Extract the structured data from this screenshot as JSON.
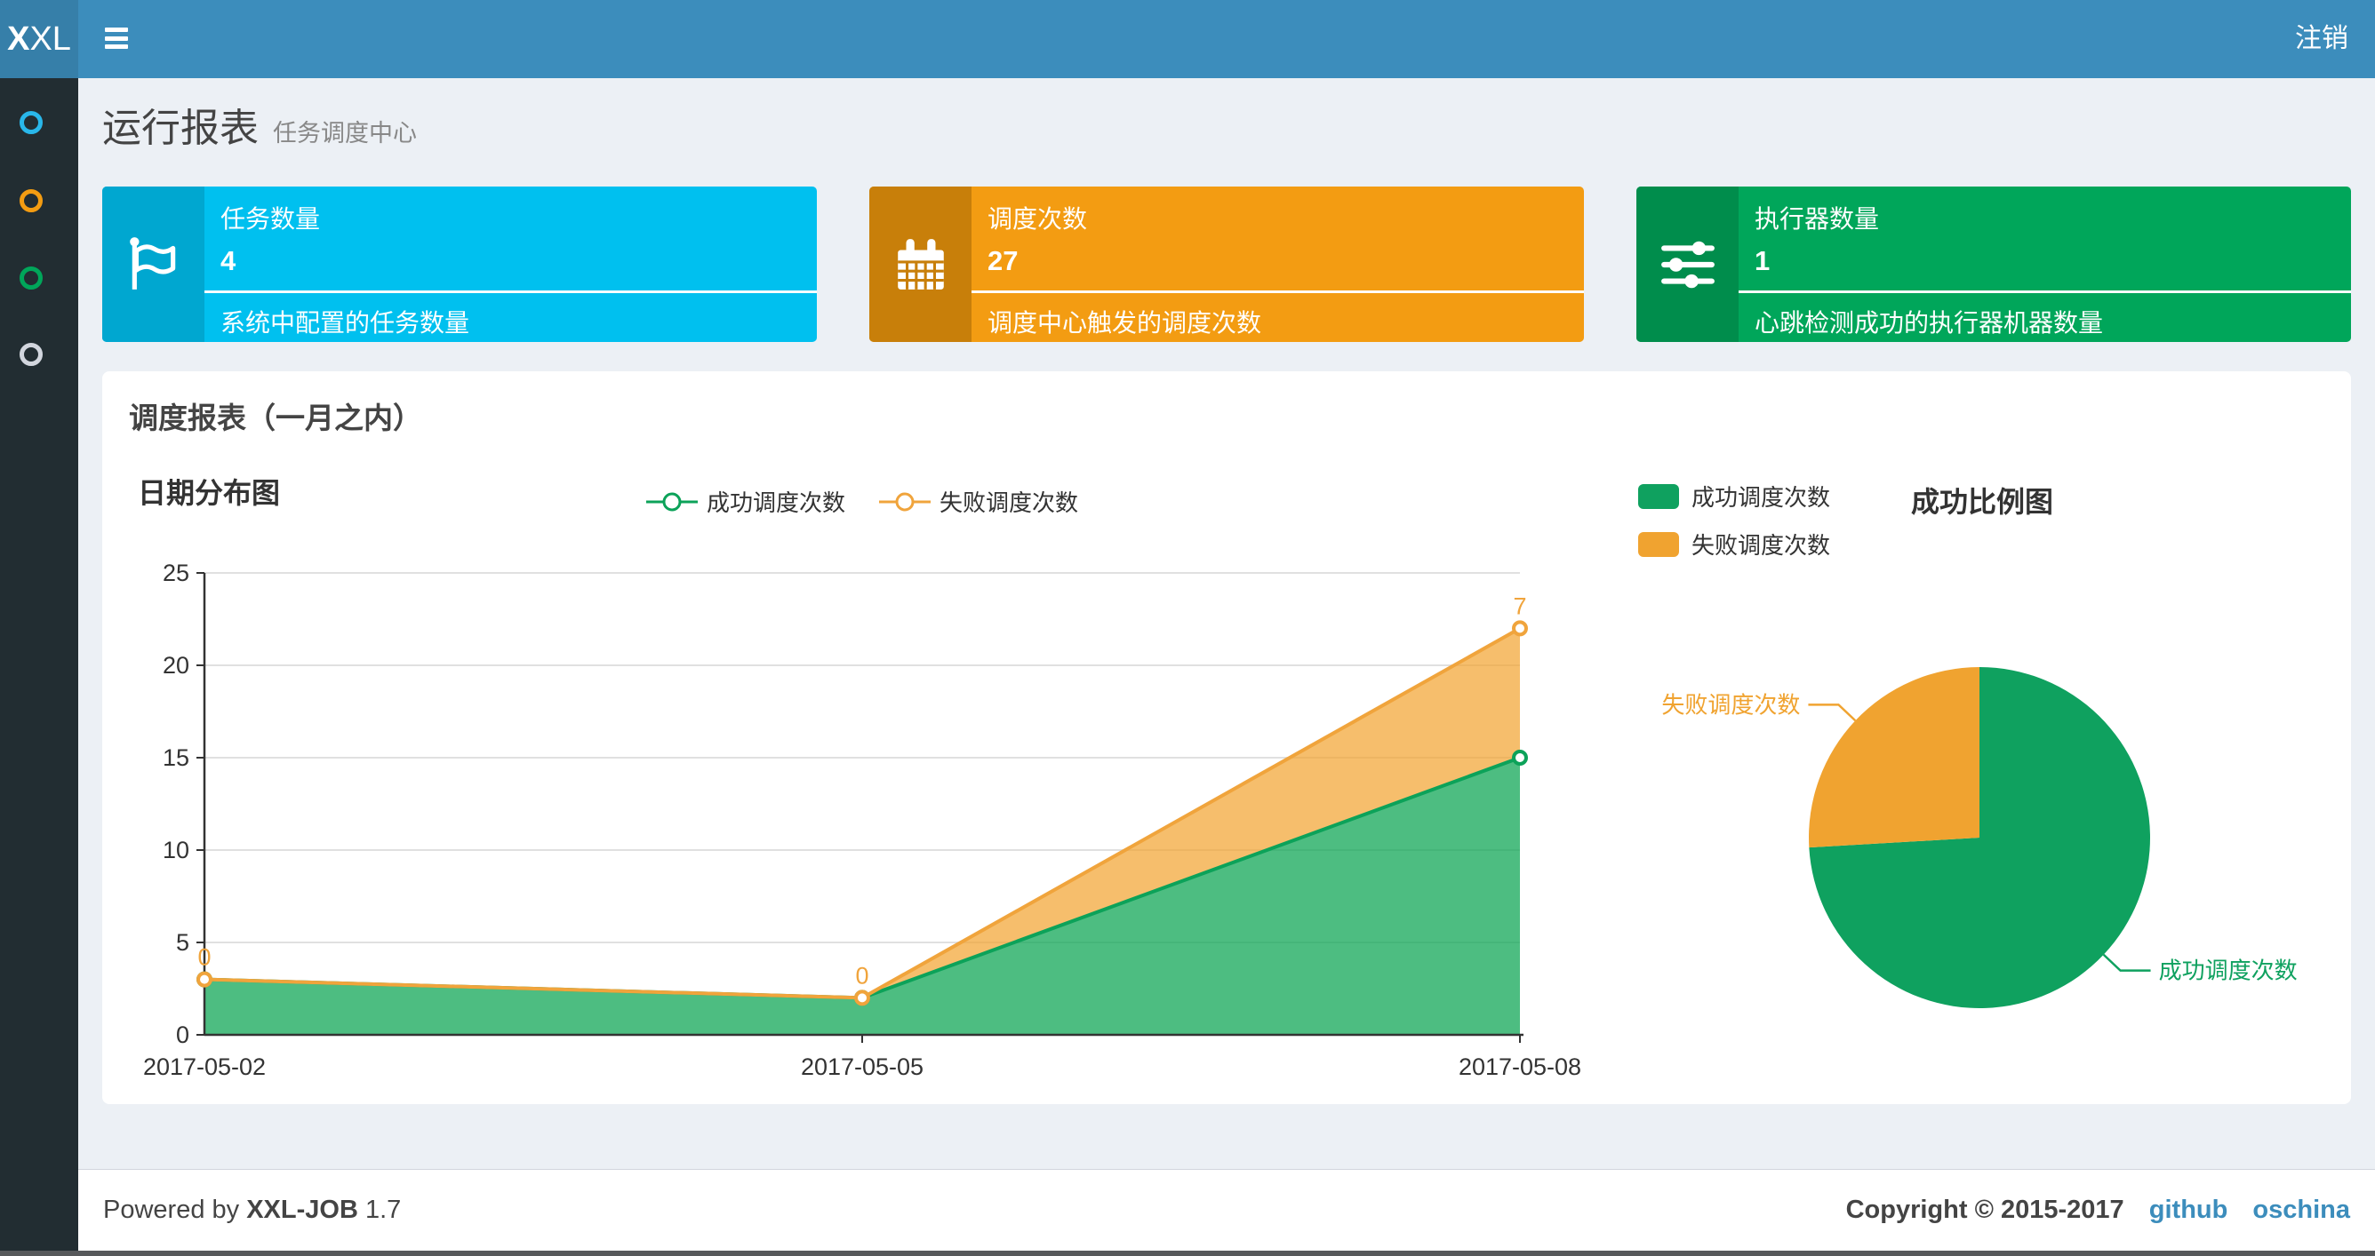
{
  "header": {
    "logo_bold": "X",
    "logo_light": "XL",
    "logout_label": "注销"
  },
  "sidebar": {
    "items": [
      {
        "name": "menu-jobs",
        "color": "#29b7ea"
      },
      {
        "name": "menu-schedule",
        "color": "#f39c12"
      },
      {
        "name": "menu-executors",
        "color": "#00a65a"
      },
      {
        "name": "menu-other",
        "color": "#d2d6de"
      }
    ]
  },
  "page": {
    "title": "运行报表",
    "subtitle": "任务调度中心"
  },
  "stat_cards": [
    {
      "icon": "flag-icon",
      "label": "任务数量",
      "value": "4",
      "desc": "系统中配置的任务数量",
      "bg": "#00c0ef",
      "icon_bg": "#00a7d0"
    },
    {
      "icon": "calendar-icon",
      "label": "调度次数",
      "value": "27",
      "desc": "调度中心触发的调度次数",
      "bg": "#f39c12",
      "icon_bg": "#c87f0a"
    },
    {
      "icon": "sliders-icon",
      "label": "执行器数量",
      "value": "1",
      "desc": "心跳检测成功的执行器机器数量",
      "bg": "#00a65a",
      "icon_bg": "#008d4c"
    }
  ],
  "panel": {
    "title": "调度报表（一月之内）"
  },
  "chart_data": [
    {
      "type": "area",
      "title": "日期分布图",
      "x": [
        "2017-05-02",
        "2017-05-05",
        "2017-05-08"
      ],
      "series": [
        {
          "name": "成功调度次数",
          "values": [
            3,
            2,
            15
          ],
          "color": "#0ca259",
          "area_color": "#08a351",
          "area_opacity": 0.72,
          "show_labels": false
        },
        {
          "name": "失败调度次数",
          "values": [
            0,
            0,
            7
          ],
          "color": "#f0a43c",
          "area_color": "#f2a32e",
          "area_opacity": 0.7,
          "show_labels": true
        }
      ],
      "stacked": true,
      "ylim": [
        0,
        25
      ],
      "yticks": [
        0,
        5,
        10,
        15,
        20,
        25
      ],
      "grid": true,
      "legend_position": "top-center",
      "axis_color": "#333333",
      "grid_color": "#e0e0e0"
    },
    {
      "type": "pie",
      "title": "成功比例图",
      "slices": [
        {
          "name": "成功调度次数",
          "value": 20,
          "color": "#0fa15f"
        },
        {
          "name": "失败调度次数",
          "value": 7,
          "color": "#f0a330"
        }
      ],
      "legend_position": "top-left"
    }
  ],
  "footer": {
    "powered_prefix": "Powered by",
    "product": "XXL-JOB",
    "version": "1.7",
    "copyright": "Copyright © 2015-2017",
    "links": [
      {
        "label": "github"
      },
      {
        "label": "oschina"
      }
    ]
  },
  "colors": {
    "navbar": "#3c8dbc",
    "logo_bg": "#367fa9",
    "sidebar_bg": "#222d32",
    "content_bg": "#ecf0f5",
    "link": "#3c8dbc"
  }
}
